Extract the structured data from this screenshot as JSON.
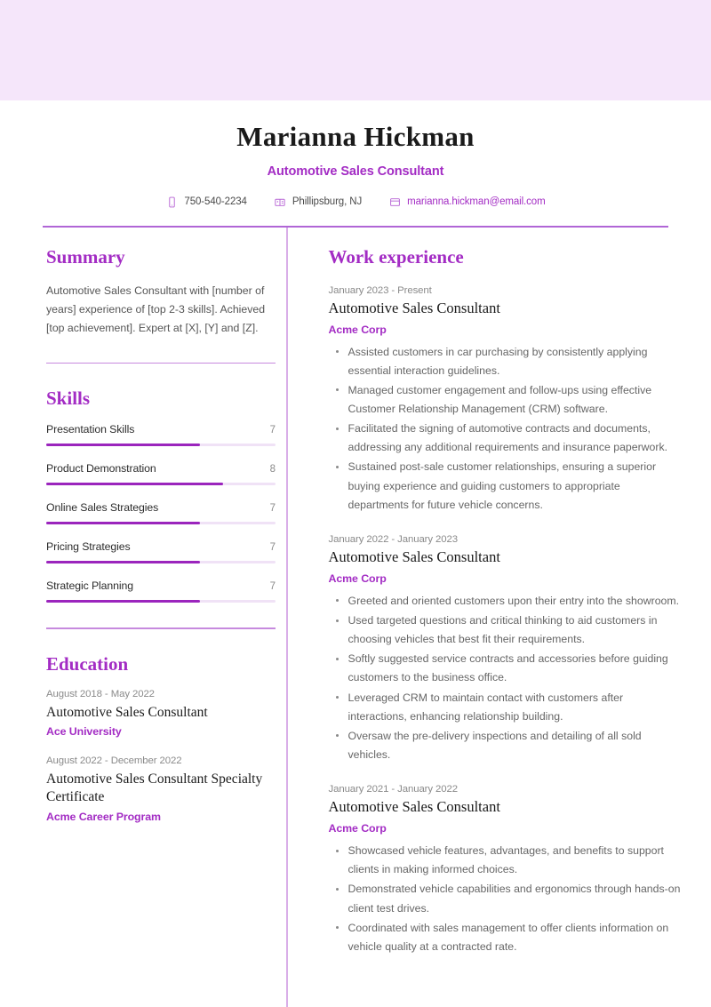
{
  "theme": {
    "banner_bg": "#f5e6fa",
    "accent": "#a32cc4",
    "bar_fill": "#9b25bd",
    "bar_track": "#f0e2f6",
    "rule": "#b066d6",
    "divider": "#d9aee8"
  },
  "header": {
    "full_name": "Marianna Hickman",
    "job_title": "Automotive Sales Consultant",
    "contacts": [
      {
        "icon": "phone-icon",
        "text": "750-540-2234",
        "type": "phone"
      },
      {
        "icon": "location-icon",
        "text": "Phillipsburg, NJ",
        "type": "location"
      },
      {
        "icon": "email-icon",
        "text": "marianna.hickman@email.com",
        "type": "email"
      }
    ]
  },
  "left_column": {
    "summary": {
      "title": "Summary",
      "text": "Automotive Sales Consultant with [number of years] experience of [top 2-3 skills]. Achieved [top achievement]. Expert at [X], [Y] and [Z]."
    },
    "skills": {
      "title": "Skills",
      "max": 10,
      "items": [
        {
          "name": "Presentation Skills",
          "value": 7
        },
        {
          "name": "Product Demonstration",
          "value": 8
        },
        {
          "name": "Online Sales Strategies",
          "value": 7
        },
        {
          "name": "Pricing Strategies",
          "value": 7
        },
        {
          "name": "Strategic Planning",
          "value": 7
        }
      ]
    },
    "education": {
      "title": "Education",
      "entries": [
        {
          "date": "August 2018 - May 2022",
          "title": "Automotive Sales Consultant",
          "org": "Ace University"
        },
        {
          "date": "August 2022 - December 2022",
          "title": "Automotive Sales Consultant Specialty Certificate",
          "org": "Acme Career Program"
        }
      ]
    }
  },
  "right_column": {
    "work_experience": {
      "title": "Work experience",
      "jobs": [
        {
          "date": "January 2023 - Present",
          "title": "Automotive Sales Consultant",
          "org": "Acme Corp",
          "bullets": [
            "Assisted customers in car purchasing by consistently applying essential interaction guidelines.",
            "Managed customer engagement and follow-ups using effective Customer Relationship Management (CRM) software.",
            "Facilitated the signing of automotive contracts and documents, addressing any additional requirements and insurance paperwork.",
            "Sustained post-sale customer relationships, ensuring a superior buying experience and guiding customers to appropriate departments for future vehicle concerns."
          ]
        },
        {
          "date": "January 2022 - January 2023",
          "title": "Automotive Sales Consultant",
          "org": "Acme Corp",
          "bullets": [
            "Greeted and oriented customers upon their entry into the showroom.",
            "Used targeted questions and critical thinking to aid customers in choosing vehicles that best fit their requirements.",
            "Softly suggested service contracts and accessories before guiding customers to the business office.",
            "Leveraged CRM to maintain contact with customers after interactions, enhancing relationship building.",
            "Oversaw the pre-delivery inspections and detailing of all sold vehicles."
          ]
        },
        {
          "date": "January 2021 - January 2022",
          "title": "Automotive Sales Consultant",
          "org": "Acme Corp",
          "bullets": [
            "Showcased vehicle features, advantages, and benefits to support clients in making informed choices.",
            "Demonstrated vehicle capabilities and ergonomics through hands-on client test drives.",
            "Coordinated with sales management to offer clients information on vehicle quality at a contracted rate."
          ]
        }
      ]
    }
  }
}
